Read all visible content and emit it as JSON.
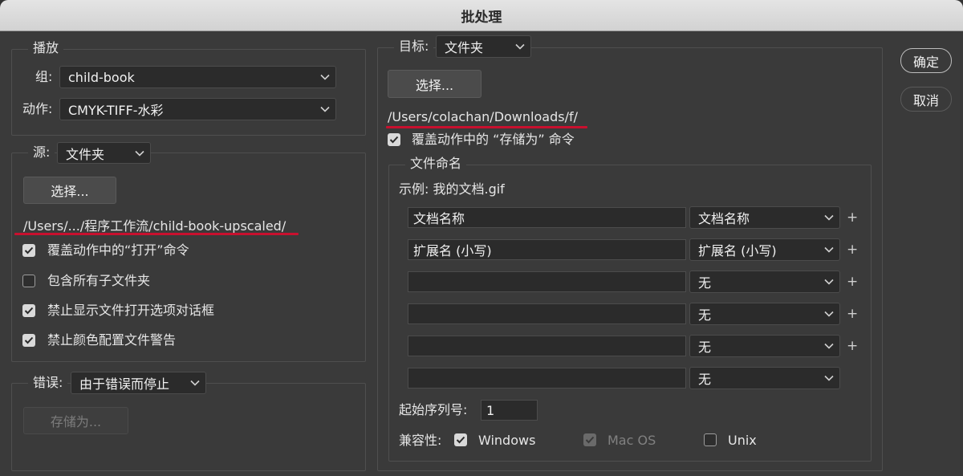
{
  "window": {
    "title": "批处理"
  },
  "buttons": {
    "ok": "确定",
    "cancel": "取消"
  },
  "play": {
    "legend": "播放",
    "set_label": "组:",
    "set_value": "child-book",
    "action_label": "动作:",
    "action_value": "CMYK-TIFF-水彩"
  },
  "source": {
    "label": "源:",
    "value": "文件夹",
    "choose_label": "选择...",
    "path": "/Users/.../程序工作流/child-book-upscaled/",
    "options": [
      {
        "label": "覆盖动作中的“打开”命令",
        "checked": true
      },
      {
        "label": "包含所有子文件夹",
        "checked": false
      },
      {
        "label": "禁止显示文件打开选项对话框",
        "checked": true
      },
      {
        "label": "禁止颜色配置文件警告",
        "checked": true
      }
    ]
  },
  "errors": {
    "label": "错误:",
    "value": "由于错误而停止",
    "save_as_label": "存储为..."
  },
  "destination": {
    "label": "目标:",
    "value": "文件夹",
    "choose_label": "选择...",
    "path": "/Users/colachan/Downloads/f/",
    "override_label": "覆盖动作中的 “存储为” 命令",
    "override_checked": true
  },
  "naming": {
    "legend": "文件命名",
    "example": "示例: 我的文档.gif",
    "rows": [
      {
        "text": "文档名称",
        "select": "文档名称",
        "plus": "+"
      },
      {
        "text": "扩展名 (小写)",
        "select": "扩展名 (小写)",
        "plus": "+"
      },
      {
        "text": "",
        "select": "无",
        "plus": "+"
      },
      {
        "text": "",
        "select": "无",
        "plus": "+"
      },
      {
        "text": "",
        "select": "无",
        "plus": "+"
      },
      {
        "text": "",
        "select": "无",
        "plus": ""
      }
    ],
    "serial_label": "起始序列号:",
    "serial_value": "1",
    "compat_label": "兼容性:",
    "compat": [
      {
        "label": "Windows",
        "checked": true,
        "disabled": false
      },
      {
        "label": "Mac OS",
        "checked": true,
        "disabled": true
      },
      {
        "label": "Unix",
        "checked": false,
        "disabled": false
      }
    ]
  },
  "colors": {
    "underline": "#c8102e",
    "dialog_bg": "#3a3a3a",
    "field_bg": "#2b2b2b"
  },
  "icons": {
    "dropdown": "chevron-down-icon",
    "check": "checkmark-icon"
  }
}
